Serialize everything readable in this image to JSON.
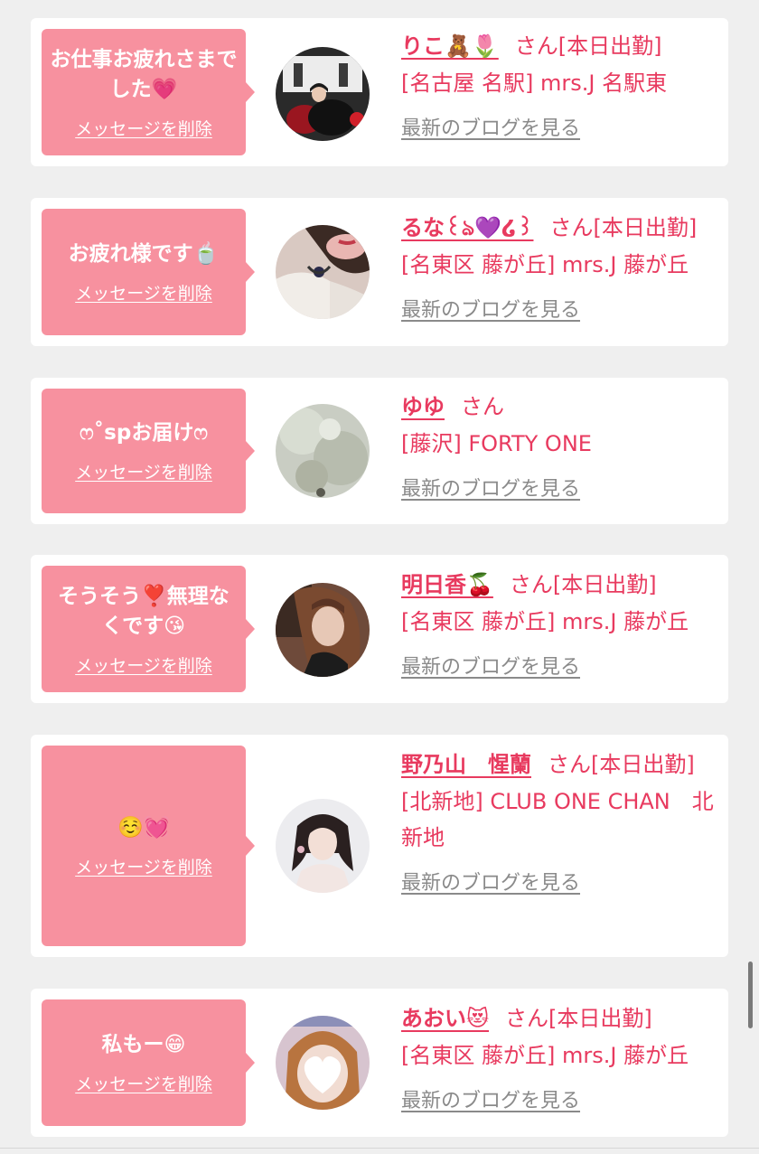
{
  "delete_label": "メッセージを削除",
  "blog_label": "最新のブログを見る",
  "colors": {
    "pink_bubble": "#f7919f",
    "name_red": "#e83a5f",
    "blog_gray": "#8a8a8a",
    "background": "#efefef"
  },
  "entries": [
    {
      "message": "お仕事お疲れさまでした💗",
      "name": "りこ🧸🌷",
      "suffix": "さん[本日出勤]",
      "shop": "[名古屋 名駅] mrs.J 名駅東"
    },
    {
      "message": "お疲れ様です🍵",
      "name": "るな꒰ঌ💜໒꒱",
      "suffix": "さん[本日出勤]",
      "shop": "[名東区 藤が丘] mrs.J 藤が丘"
    },
    {
      "message": "ෆ˚spお届けෆ",
      "name": "ゆゆ",
      "suffix": "さん",
      "shop": "[藤沢] FORTY ONE"
    },
    {
      "message": "そうそう❣️無理なくです😘",
      "name": "明日香🍒",
      "suffix": "さん[本日出勤]",
      "shop": "[名東区 藤が丘] mrs.J 藤が丘"
    },
    {
      "message": "☺️💓",
      "name": "野乃山　惺蘭",
      "suffix": "さん[本日出勤]",
      "shop": "[北新地] CLUB ONE CHAN　北新地"
    },
    {
      "message": "私もー😁",
      "name": "あおい😻",
      "suffix": "さん[本日出勤]",
      "shop": "[名東区 藤が丘] mrs.J 藤が丘"
    }
  ]
}
